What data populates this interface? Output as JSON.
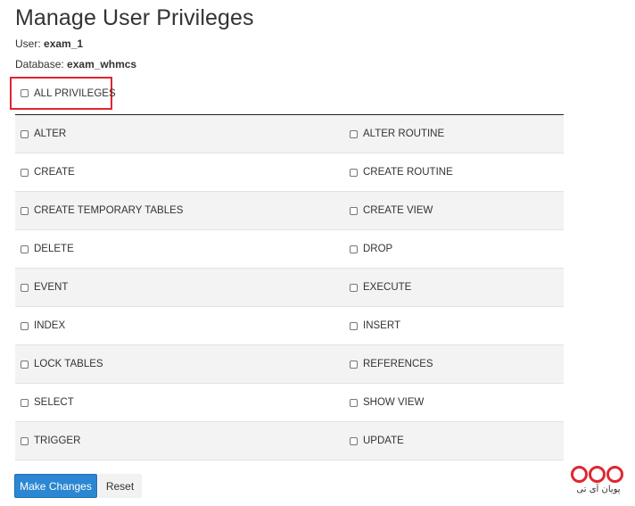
{
  "page": {
    "title": "Manage User Privileges",
    "user_label": "User:",
    "user_value": "exam_1",
    "database_label": "Database:",
    "database_value": "exam_whmcs"
  },
  "all_privileges": {
    "label": "ALL PRIVILEGES",
    "checked": false
  },
  "privileges": {
    "rows": [
      {
        "left": "ALTER",
        "right": "ALTER ROUTINE"
      },
      {
        "left": "CREATE",
        "right": "CREATE ROUTINE"
      },
      {
        "left": "CREATE TEMPORARY TABLES",
        "right": "CREATE VIEW"
      },
      {
        "left": "DELETE",
        "right": "DROP"
      },
      {
        "left": "EVENT",
        "right": "EXECUTE"
      },
      {
        "left": "INDEX",
        "right": "INSERT"
      },
      {
        "left": "LOCK TABLES",
        "right": "REFERENCES"
      },
      {
        "left": "SELECT",
        "right": "SHOW VIEW"
      },
      {
        "left": "TRIGGER",
        "right": "UPDATE"
      }
    ]
  },
  "actions": {
    "make_changes_label": "Make Changes",
    "reset_label": "Reset"
  },
  "watermark": {
    "text": "پویان آی تی"
  },
  "colors": {
    "highlight_border": "#e0262f",
    "primary_button": "#2b87d1",
    "row_striped": "#f3f3f3",
    "logo_red": "#e0262f"
  }
}
